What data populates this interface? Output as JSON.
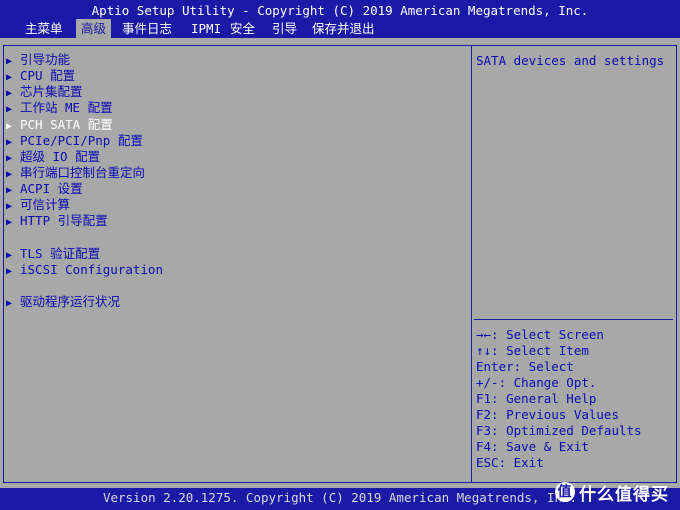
{
  "header": {
    "title": "Aptio Setup Utility - Copyright (C) 2019 American Megatrends, Inc."
  },
  "tabs": [
    {
      "label": "主菜单"
    },
    {
      "label": "高级"
    },
    {
      "label": "事件日志"
    },
    {
      "label": "IPMI"
    },
    {
      "label": "安全"
    },
    {
      "label": "引导"
    },
    {
      "label": "保存并退出"
    }
  ],
  "menu": [
    {
      "label": "引导功能"
    },
    {
      "label": "CPU 配置"
    },
    {
      "label": "芯片集配置"
    },
    {
      "label": "工作站 ME 配置"
    },
    {
      "label": "PCH SATA 配置"
    },
    {
      "label": "PCIe/PCI/Pnp 配置"
    },
    {
      "label": "超级 IO 配置"
    },
    {
      "label": "串行端口控制台重定向"
    },
    {
      "label": "ACPI 设置"
    },
    {
      "label": "可信计算"
    },
    {
      "label": "HTTP 引导配置"
    },
    {
      "label": "TLS 验证配置"
    },
    {
      "label": "iSCSI Configuration"
    },
    {
      "label": "驱动程序运行状况"
    }
  ],
  "help": {
    "description": "SATA devices and settings",
    "keys": [
      "→←: Select Screen",
      "↑↓: Select Item",
      "Enter: Select",
      "+/-: Change Opt.",
      "F1: General Help",
      "F2: Previous Values",
      "F3: Optimized Defaults",
      "F4: Save & Exit",
      "ESC: Exit"
    ]
  },
  "footer": {
    "text": "Version 2.20.1275. Copyright (C) 2019 American Megatrends, Inc."
  },
  "watermark": {
    "logo_char": "值",
    "text": "什么值得买"
  },
  "colors": {
    "frame_blue": "#1a1aa6",
    "panel_gray": "#a8a8a8",
    "text_blue": "#0a0ab4",
    "selected_white": "#ffffff"
  }
}
